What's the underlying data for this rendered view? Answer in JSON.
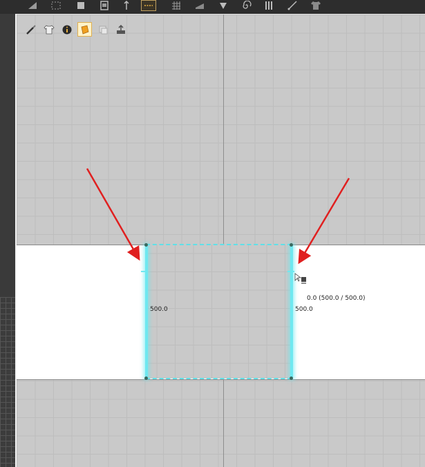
{
  "toolbar": {
    "icons": [
      "pattern-transform-icon",
      "points-icon",
      "rectangle-icon",
      "polygon-icon",
      "pin-icon",
      "segment-tape-icon",
      "grid-icon",
      "folder-icon",
      "fold-icon",
      "spiral-icon",
      "bars-icon",
      "line-icon",
      "tshirt-icon"
    ],
    "active": "segment-tape-icon"
  },
  "viewport_tools": {
    "icons": [
      "brush-icon",
      "garment-icon",
      "info-icon",
      "sheet-icon",
      "stack-icon",
      "export-icon"
    ],
    "active": "sheet-icon"
  },
  "measurements": {
    "left_length": "500.0",
    "right_length": "500.0",
    "segment_ratio": "0.0 (500.0 / 500.0)"
  },
  "colors": {
    "seam": "#6fe8f0",
    "arrow": "#e02020",
    "fabric": "#ffffff",
    "grid_bg": "#c9c9c9"
  }
}
